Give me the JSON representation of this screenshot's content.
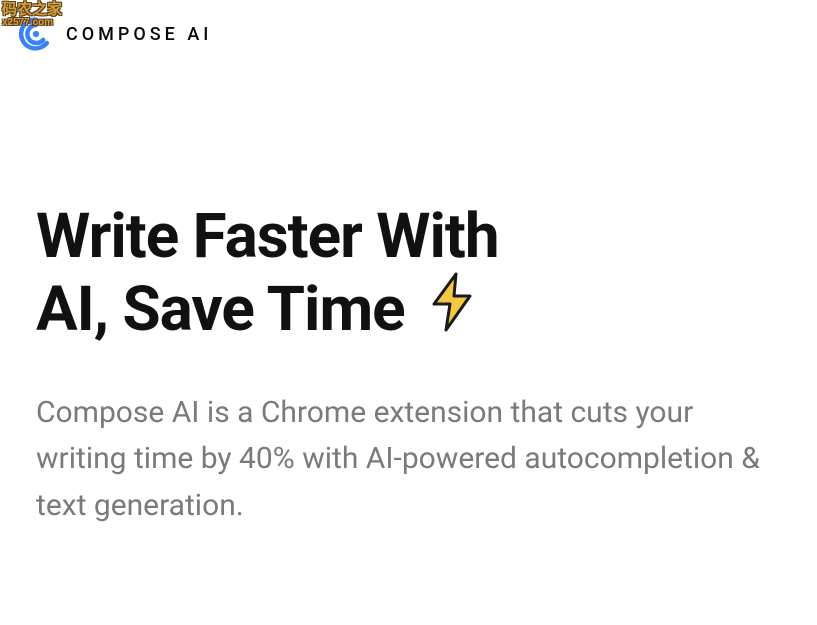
{
  "watermark": {
    "title": "码农之家",
    "subtitle": "x2577.com"
  },
  "header": {
    "brand": "COMPOSE AI"
  },
  "hero": {
    "headline_line1": "Write Faster With",
    "headline_line2": "AI, Save Time",
    "subtitle": "Compose AI is a Chrome extension that cuts your writing time by 40% with AI-powered autocompletion & text generation."
  }
}
